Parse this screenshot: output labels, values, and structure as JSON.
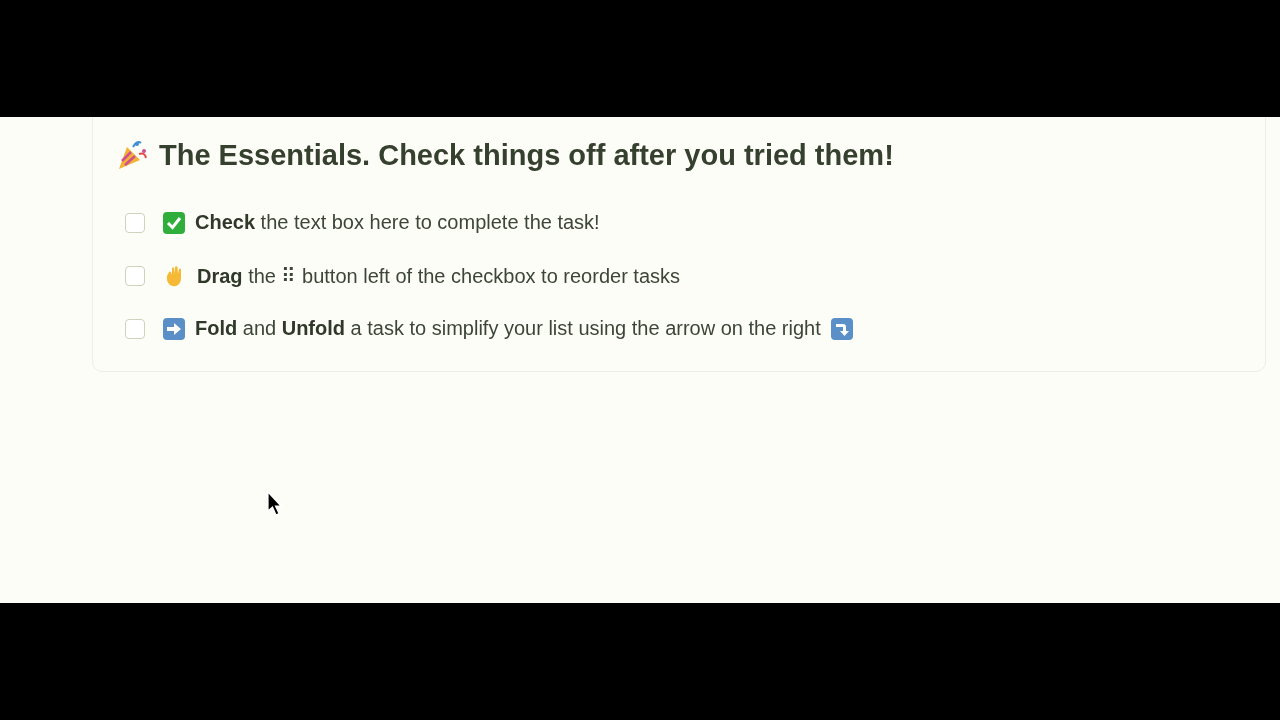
{
  "heading": {
    "title": "The Essentials. Check things off after you tried them!"
  },
  "tasks": [
    {
      "text": "**Check** the text box here to complete the task!",
      "checked": false
    },
    {
      "text": "**Drag** the ⠿ button left of the checkbox to reorder tasks",
      "checked": false
    },
    {
      "text": "**Fold** and **Unfold** a task to simplify your list using the arrow on the right",
      "checked": false
    }
  ]
}
